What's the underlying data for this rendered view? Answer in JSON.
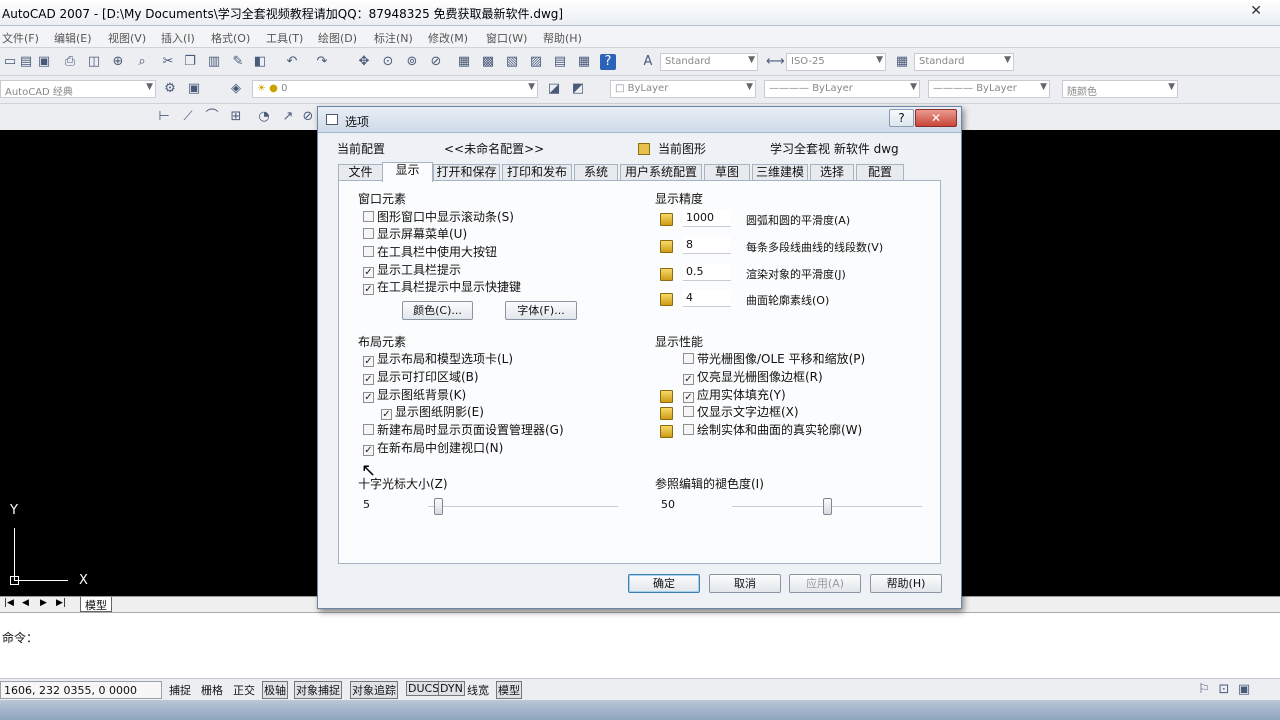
{
  "app": {
    "title": "AutoCAD 2007 - [D:\\My Documents\\学习全套视频教程请加QQ：87948325    免费获取最新软件.dwg]",
    "close_glyph": "✕"
  },
  "menu": [
    "文件(F)",
    "编辑(E)",
    "视图(V)",
    "插入(I)",
    "格式(O)",
    "工具(T)",
    "绘图(D)",
    "标注(N)",
    "修改(M)",
    "窗口(W)",
    "帮助(H)"
  ],
  "toolbar": {
    "text_style": "Standard",
    "dim_style": "ISO-25",
    "table_style": "Standard",
    "workspace": "AutoCAD 经典",
    "layer": "0",
    "color": "ByLayer",
    "linetype": "ByLayer",
    "lineweight": "ByLayer",
    "plotstyle": "随颜色"
  },
  "drawing": {
    "axis_y": "Y",
    "axis_x": "X"
  },
  "layout_tabs": {
    "model": "模型"
  },
  "command": {
    "label": "命令："
  },
  "status": {
    "coords": "1606, 232 0355, 0 0000",
    "buttons": [
      "捕捉",
      "栅格",
      "正交",
      "极轴",
      "对象捕捉",
      "对象追踪",
      "DUCS",
      "DYN",
      "线宽",
      "模型"
    ]
  },
  "dialog": {
    "title": "选项",
    "help_glyph": "?",
    "close_glyph": "✕",
    "current_profile_label": "当前配置",
    "current_profile_value": "<<未命名配置>>",
    "current_drawing_label": "当前图形",
    "current_drawing_value": "学习全套视    新软件  dwg",
    "tabs": [
      "文件",
      "显示",
      "打开和保存",
      "打印和发布",
      "系统",
      "用户系统配置",
      "草图",
      "三维建模",
      "选择",
      "配置"
    ],
    "window_elements": {
      "title": "窗口元素",
      "options": [
        {
          "label": "图形窗口中显示滚动条(S)",
          "checked": false
        },
        {
          "label": "显示屏幕菜单(U)",
          "checked": false
        },
        {
          "label": "在工具栏中使用大按钮",
          "checked": false
        },
        {
          "label": "显示工具栏提示",
          "checked": true
        },
        {
          "label": "在工具栏提示中显示快捷键",
          "checked": true
        }
      ],
      "colors_button": "颜色(C)...",
      "fonts_button": "字体(F)..."
    },
    "layout_elements": {
      "title": "布局元素",
      "options": [
        {
          "label": "显示布局和模型选项卡(L)",
          "checked": true
        },
        {
          "label": "显示可打印区域(B)",
          "checked": true
        },
        {
          "label": "显示图纸背景(K)",
          "checked": true
        },
        {
          "label": "显示图纸阴影(E)",
          "checked": true
        },
        {
          "label": "新建布局时显示页面设置管理器(G)",
          "checked": false
        },
        {
          "label": "在新布局中创建视口(N)",
          "checked": true
        }
      ]
    },
    "display_resolution": {
      "title": "显示精度",
      "items": [
        {
          "value": "1000",
          "label": "圆弧和圆的平滑度(A)"
        },
        {
          "value": "8",
          "label": "每条多段线曲线的线段数(V)"
        },
        {
          "value": "0.5",
          "label": "渲染对象的平滑度(J)"
        },
        {
          "value": "4",
          "label": "曲面轮廓素线(O)"
        }
      ]
    },
    "display_performance": {
      "title": "显示性能",
      "options": [
        {
          "label": "带光栅图像/OLE 平移和缩放(P)",
          "checked": false
        },
        {
          "label": "仅亮显光栅图像边框(R)",
          "checked": true
        },
        {
          "label": "应用实体填充(Y)",
          "checked": true
        },
        {
          "label": "仅显示文字边框(X)",
          "checked": false
        },
        {
          "label": "绘制实体和曲面的真实轮廓(W)",
          "checked": false
        }
      ]
    },
    "crosshair": {
      "label": "十字光标大小(Z)",
      "value": "5",
      "fraction": 0.05
    },
    "xref_fading": {
      "label": "参照编辑的褪色度(I)",
      "value": "50",
      "fraction": 0.5
    },
    "buttons": {
      "ok": "确定",
      "cancel": "取消",
      "apply": "应用(A)",
      "help": "帮助(H)"
    }
  }
}
